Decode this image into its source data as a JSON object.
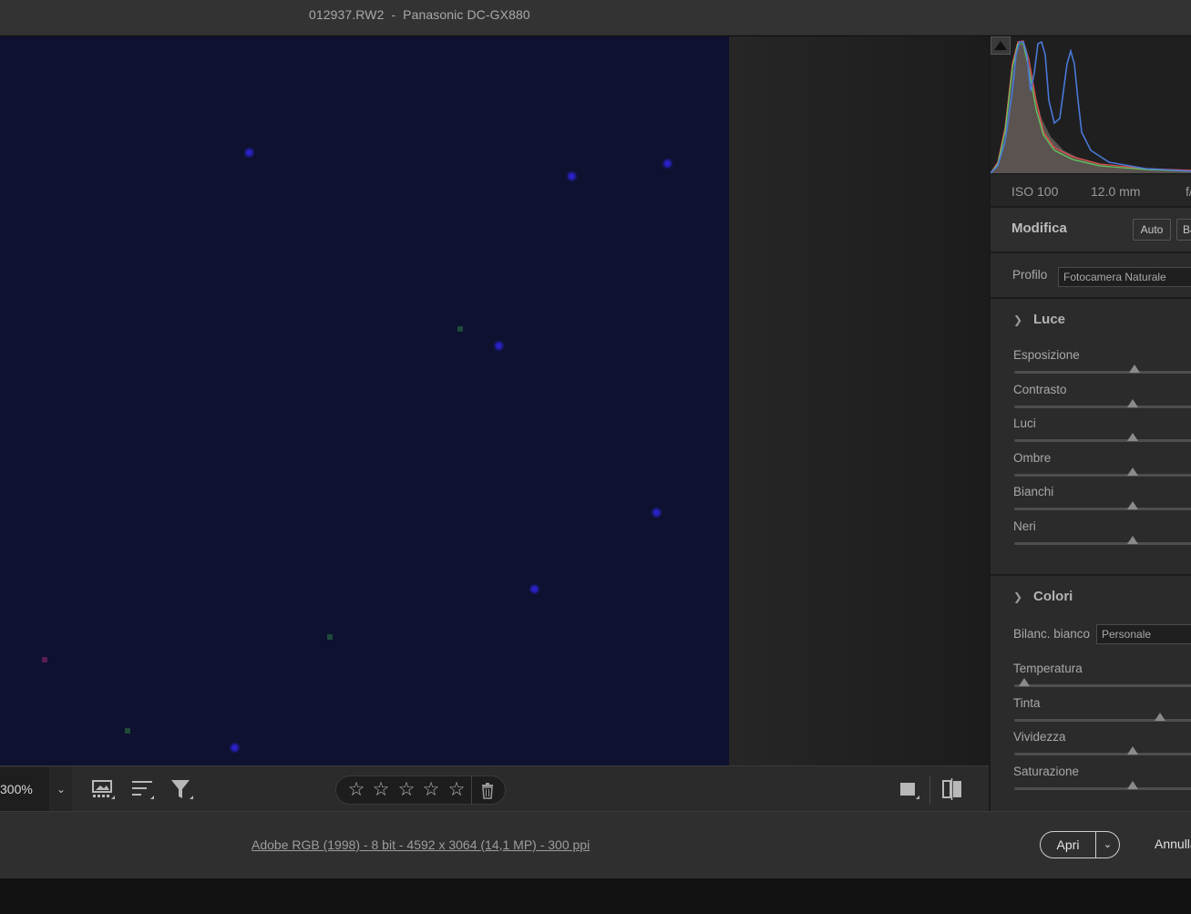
{
  "window": {
    "title": "012937.RW2  -  Panasonic DC-GX880"
  },
  "toolbar": {
    "zoom_value": "300%",
    "zoom_dropdown_icon": "chevron-down-icon",
    "rating_stars": [
      "☆",
      "☆",
      "☆",
      "☆",
      "☆"
    ],
    "icons": [
      "filmstrip-icon",
      "sort-icon",
      "filter-icon",
      "single-view-icon",
      "before-after-icon",
      "trash-icon"
    ]
  },
  "histogram": {
    "clip_warning_icon": "shadow-clipping-icon"
  },
  "exif": {
    "iso": "ISO 100",
    "focal": "12.0 mm",
    "aperture": "f/"
  },
  "edit": {
    "title": "Modifica",
    "auto_label": "Auto",
    "bw_label": "B&",
    "profile_label": "Profilo",
    "profile_value": "Fotocamera Naturale"
  },
  "light": {
    "title": "Luce",
    "sliders": [
      {
        "label": "Esposizione",
        "position": 0.63
      },
      {
        "label": "Contrasto",
        "position": 0.62
      },
      {
        "label": "Luci",
        "position": 0.62
      },
      {
        "label": "Ombre",
        "position": 0.62
      },
      {
        "label": "Bianchi",
        "position": 0.62
      },
      {
        "label": "Neri",
        "position": 0.62
      }
    ]
  },
  "color": {
    "title": "Colori",
    "wb_label": "Bilanc. bianco",
    "wb_value": "Personale",
    "sliders": [
      {
        "label": "Temperatura",
        "position": 0.05
      },
      {
        "label": "Tinta",
        "position": 0.76
      },
      {
        "label": "Vividezza",
        "position": 0.62
      },
      {
        "label": "Saturazione",
        "position": 0.62
      }
    ]
  },
  "footer": {
    "info": "Adobe RGB (1998) - 8 bit - 4592 x 3064 (14,1 MP) - 300 ppi",
    "open_label": "Apri",
    "cancel_label": "Annulla"
  },
  "colors": {
    "accent_blue": "#2a21c9",
    "photo_bg": "#0e1230",
    "panel_bg": "#2b2b2b"
  }
}
